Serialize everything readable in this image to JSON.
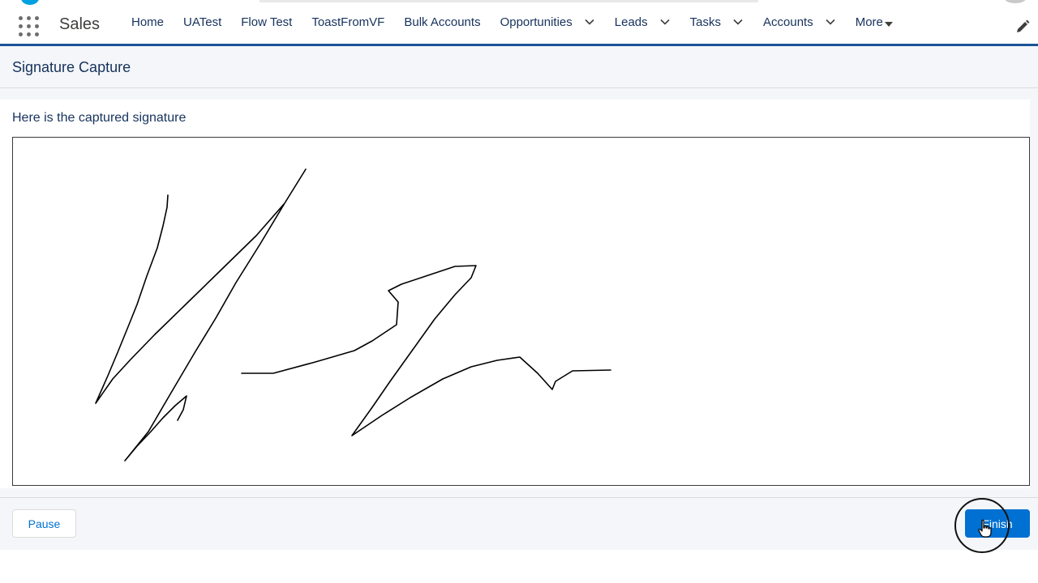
{
  "app": {
    "name": "Sales"
  },
  "nav": {
    "items": [
      {
        "label": "Home",
        "has_dropdown": false
      },
      {
        "label": "UATest",
        "has_dropdown": false
      },
      {
        "label": "Flow Test",
        "has_dropdown": false
      },
      {
        "label": "ToastFromVF",
        "has_dropdown": false
      },
      {
        "label": "Bulk Accounts",
        "has_dropdown": false
      },
      {
        "label": "Opportunities",
        "has_dropdown": true
      },
      {
        "label": "Leads",
        "has_dropdown": true
      },
      {
        "label": "Tasks",
        "has_dropdown": true
      },
      {
        "label": "Accounts",
        "has_dropdown": true
      }
    ],
    "more_label": "More"
  },
  "page": {
    "title": "Signature Capture",
    "caption": "Here is the captured signature"
  },
  "footer": {
    "pause_label": "Pause",
    "finish_label": "Finish"
  },
  "icons": {
    "app_launcher": "waffle-grid-icon",
    "dropdown": "chevron-down-icon",
    "more": "triangle-down-icon",
    "edit": "pencil-icon",
    "cursor": "hand-pointer-icon"
  },
  "colors": {
    "brand_blue": "#0070d2",
    "nav_underline": "#1b5297",
    "text_dark": "#16325c",
    "background_gray": "#f4f6f9",
    "logo_cyan": "#00a1e0"
  }
}
